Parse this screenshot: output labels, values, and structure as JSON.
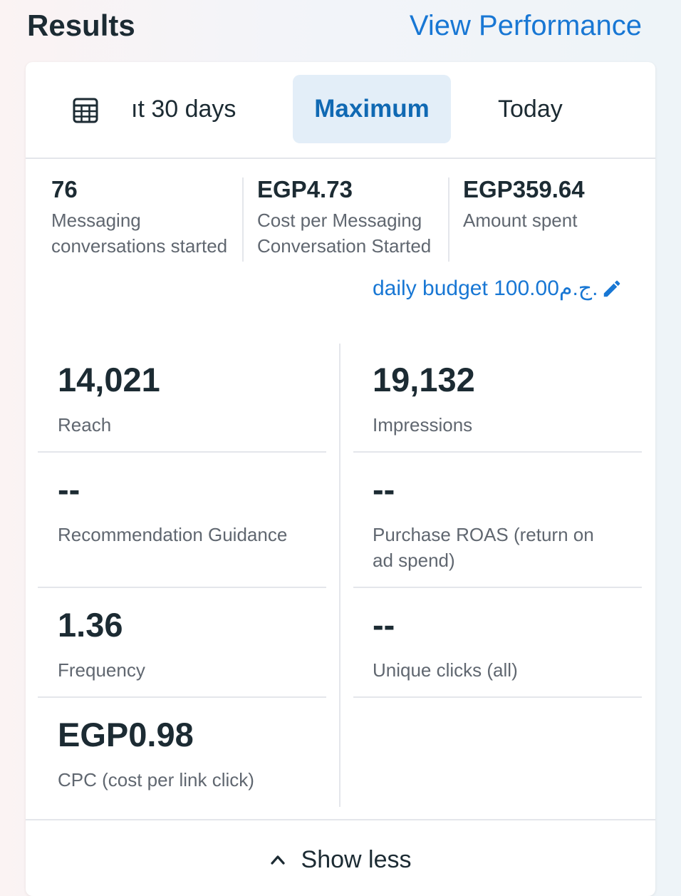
{
  "header": {
    "title": "Results",
    "link": "View Performance"
  },
  "date_tabs": {
    "calendar_icon": "calendar-icon",
    "last30": "ıt 30 days",
    "maximum": "Maximum",
    "today": "Today"
  },
  "summary": [
    {
      "value": "76",
      "label1": "Messaging",
      "label2": "conversations started"
    },
    {
      "value": "EGP4.73",
      "label1": "Cost per Messaging",
      "label2": "Conversation Started"
    },
    {
      "value": "EGP359.64",
      "label1": "Amount spent",
      "label2": ""
    }
  ],
  "budget": {
    "text": "daily budget 100.00ج.م.",
    "icon": "pencil-icon"
  },
  "metrics": [
    {
      "value": "14,021",
      "label1": "Reach",
      "label2": ""
    },
    {
      "value": "19,132",
      "label1": "Impressions",
      "label2": ""
    },
    {
      "value": "--",
      "label1": "Recommendation Guidance",
      "label2": ""
    },
    {
      "value": "--",
      "label1": "Purchase ROAS (return on",
      "label2": "ad spend)"
    },
    {
      "value": "1.36",
      "label1": "Frequency",
      "label2": ""
    },
    {
      "value": "--",
      "label1": "Unique clicks (all)",
      "label2": ""
    },
    {
      "value": "EGP0.98",
      "label1": "CPC (cost per link click)",
      "label2": ""
    }
  ],
  "footer": {
    "show_less": "Show less",
    "icon": "chevron-up-icon"
  },
  "colors": {
    "accent": "#1877d4",
    "selected_tab_bg": "#e3eef8",
    "text": "#1c2b33",
    "muted": "#606770"
  }
}
